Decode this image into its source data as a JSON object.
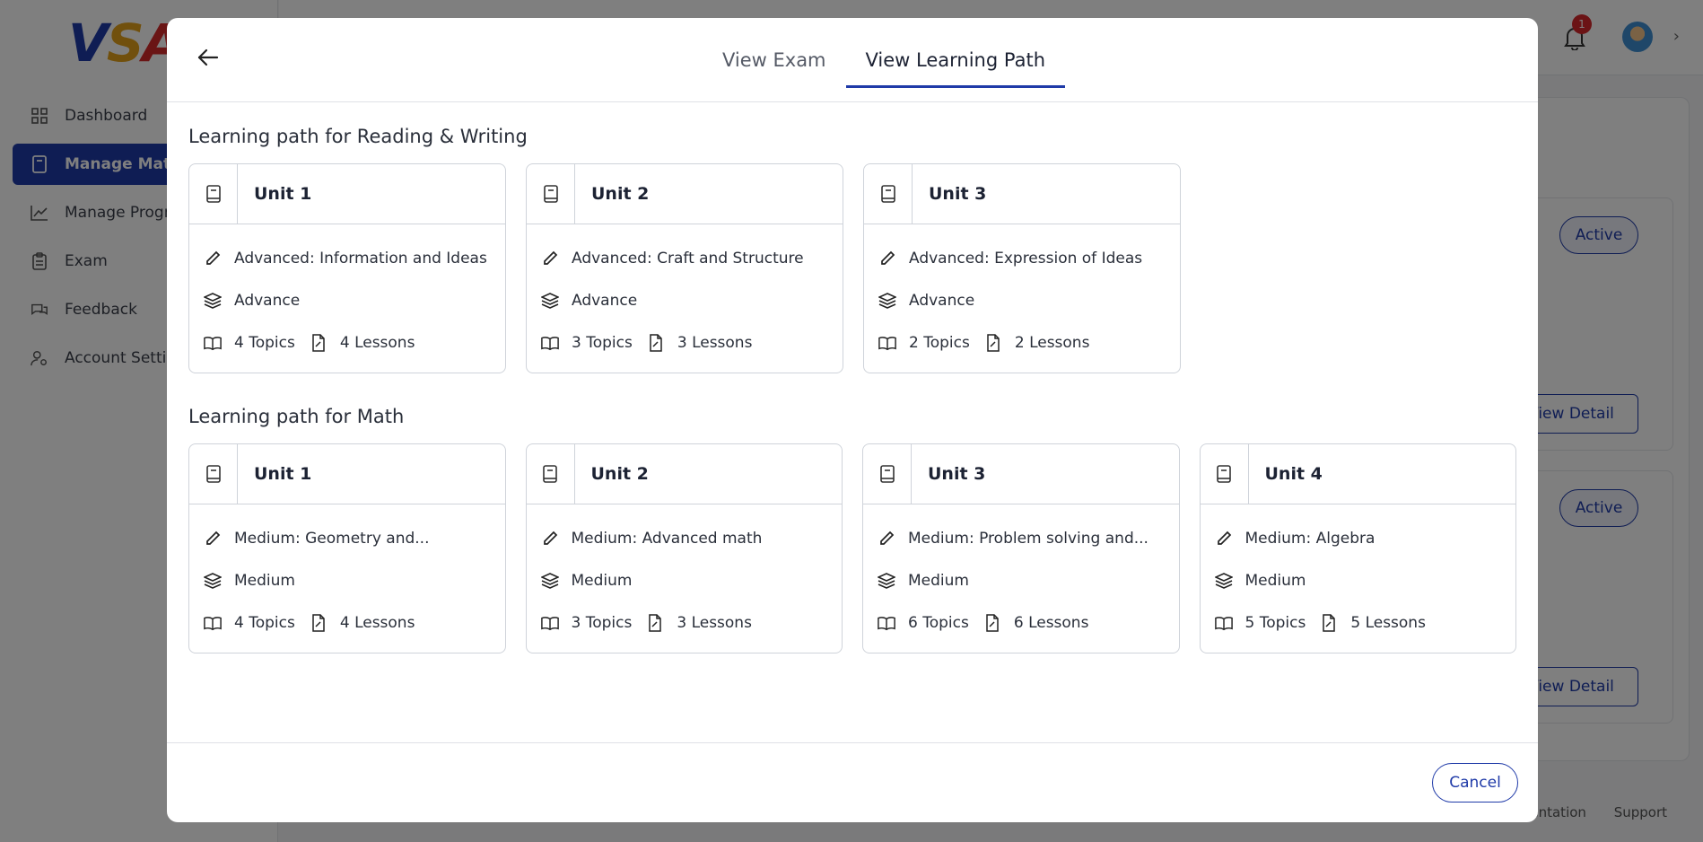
{
  "app": {
    "logo_letters": [
      "V",
      "S",
      "A"
    ],
    "sidebar": {
      "items": [
        {
          "label": "Dashboard",
          "icon": "grid-icon"
        },
        {
          "label": "Manage Materi",
          "icon": "book-icon",
          "active": true
        },
        {
          "label": "Manage Progre",
          "icon": "chart-line-icon"
        },
        {
          "label": "Exam",
          "icon": "clipboard-icon"
        },
        {
          "label": "Feedback",
          "icon": "chat-icon"
        },
        {
          "label": "Account Setting",
          "icon": "user-gear-icon"
        }
      ]
    },
    "topbar": {
      "notification_count": "1"
    },
    "background": {
      "status_1": "Active",
      "status_2": "Active",
      "view_detail_1": "View Detail",
      "view_detail_2": "View Detail",
      "footer_documentation": "mentation",
      "footer_support": "Support"
    }
  },
  "modal": {
    "tabs": [
      {
        "label": "View Exam",
        "active": false
      },
      {
        "label": "View Learning Path",
        "active": true
      }
    ],
    "sections": [
      {
        "title": "Learning path for Reading & Writing",
        "units": [
          {
            "title": "Unit 1",
            "name": "Advanced: Information and Ideas",
            "level": "Advance",
            "topics": "4 Topics",
            "lessons": "4 Lessons"
          },
          {
            "title": "Unit 2",
            "name": "Advanced: Craft and Structure",
            "level": "Advance",
            "topics": "3 Topics",
            "lessons": "3 Lessons"
          },
          {
            "title": "Unit 3",
            "name": "Advanced: Expression of Ideas",
            "level": "Advance",
            "topics": "2 Topics",
            "lessons": "2 Lessons"
          }
        ]
      },
      {
        "title": "Learning path for Math",
        "units": [
          {
            "title": "Unit 1",
            "name": "Medium: Geometry and...",
            "level": "Medium",
            "topics": "4 Topics",
            "lessons": "4 Lessons"
          },
          {
            "title": "Unit 2",
            "name": "Medium: Advanced math",
            "level": "Medium",
            "topics": "3 Topics",
            "lessons": "3 Lessons"
          },
          {
            "title": "Unit 3",
            "name": "Medium: Problem solving and...",
            "level": "Medium",
            "topics": "6 Topics",
            "lessons": "6 Lessons"
          },
          {
            "title": "Unit 4",
            "name": "Medium: Algebra",
            "level": "Medium",
            "topics": "5 Topics",
            "lessons": "5 Lessons"
          }
        ]
      }
    ],
    "cancel_label": "Cancel"
  },
  "colors": {
    "accent": "#1f3aa8",
    "badge": "#d6262b",
    "overlay": "rgba(0,0,0,0.5)"
  }
}
